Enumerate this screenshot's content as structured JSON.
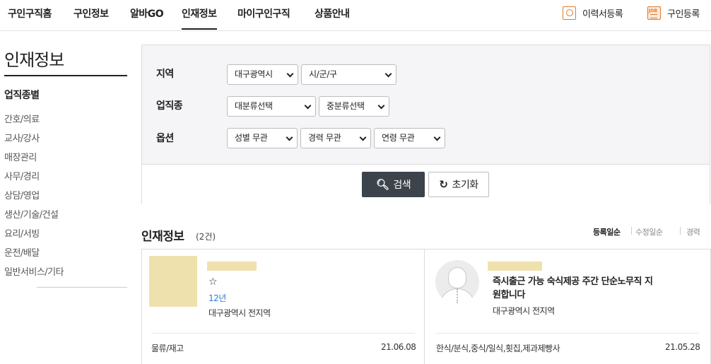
{
  "nav": {
    "tabs": [
      "구인구직홈",
      "구인정보",
      "알바GO",
      "인재정보",
      "마이구인구직",
      "상품안내"
    ],
    "active_tab": "인재정보",
    "resume_register": "이력서등록",
    "job_register": "구인등록"
  },
  "sidebar": {
    "title": "인재정보",
    "subtitle": "업직종별",
    "items": [
      "간호/의료",
      "교사/강사",
      "매장관리",
      "사무/경리",
      "상담/영업",
      "생산/기술/건설",
      "요리/서빙",
      "운전/배달",
      "일반서비스/기타"
    ]
  },
  "search": {
    "region_label": "지역",
    "region_value": "대구광역시",
    "district_value": "시/군/구",
    "jobtype_label": "업직종",
    "major_value": "대분류선택",
    "minor_value": "중분류선택",
    "option_label": "옵션",
    "gender_value": "성별 무관",
    "career_value": "경력 무관",
    "age_value": "연령 무관",
    "search_button": "검색",
    "reset_button": "초기화"
  },
  "results": {
    "title": "인재정보",
    "count": "(2건)",
    "sort_options": [
      "등록일순",
      "수정일순",
      "경력"
    ],
    "active_sort": "등록일순",
    "cards": [
      {
        "headline": "☆",
        "career": "12년",
        "region": "대구광역시 전지역",
        "category": "물류/재고",
        "date": "21.06.08"
      },
      {
        "headline": "즉시출근 가능 숙식제공 주간 단순노무직 지원합니다",
        "headline_line1": "즉시출근 가능 숙식제공 주간 단순노무직 지",
        "headline_line2": "원합니다",
        "region": "대구광역시 전지역",
        "category": "한식/분식,중식/일식,횟집,제과제빵사",
        "date": "21.05.28"
      }
    ]
  },
  "colors": {
    "accent_orange": "#e07a2e",
    "button_dark": "#3d434a",
    "placeholder_yellow": "#efe1ad",
    "career_blue": "#2b7bd6"
  }
}
